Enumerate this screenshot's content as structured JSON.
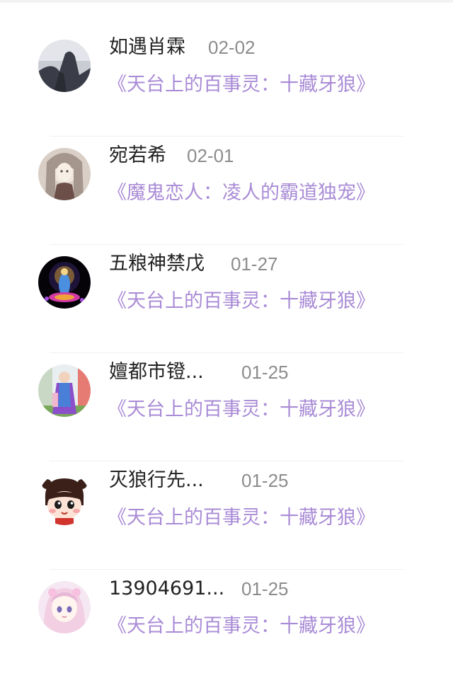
{
  "comments": [
    {
      "name": "如遇肖霖",
      "date": "02-02",
      "book": "《天台上的百事灵：十藏牙狼》"
    },
    {
      "name": "宛若希",
      "date": "02-01",
      "book": "《魔鬼恋人：凌人的霸道独宠》"
    },
    {
      "name": "五粮神禁戊",
      "date": "01-27",
      "book": "《天台上的百事灵：十藏牙狼》"
    },
    {
      "name": "嬗都市镫...",
      "date": "01-25",
      "book": "《天台上的百事灵：十藏牙狼》"
    },
    {
      "name": "灭狼行先...",
      "date": "01-25",
      "book": "《天台上的百事灵：十藏牙狼》"
    },
    {
      "name": "13904691...",
      "date": "01-25",
      "book": "《天台上的百事灵：十藏牙狼》"
    }
  ],
  "colors": {
    "name_text": "#222222",
    "date_text": "#8c8c8c",
    "book_link": "#a98bd6"
  }
}
